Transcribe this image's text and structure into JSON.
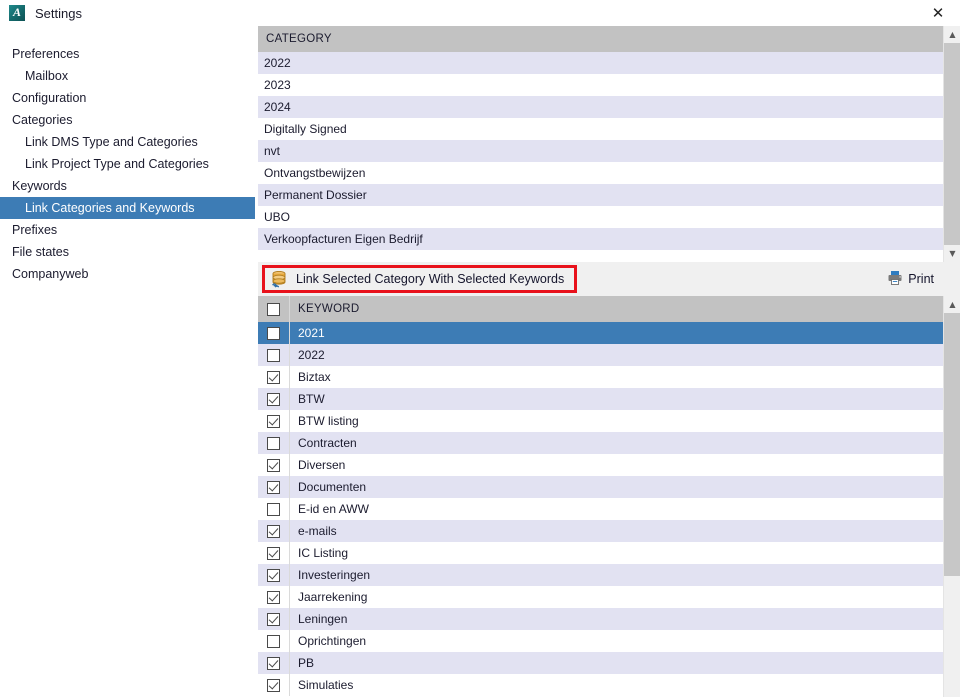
{
  "window": {
    "title": "Settings",
    "app_icon": "app-logo-icon",
    "close_label": "✕"
  },
  "sidebar": {
    "items": [
      {
        "label": "Preferences",
        "level": 0,
        "selected": false
      },
      {
        "label": "Mailbox",
        "level": 1,
        "selected": false
      },
      {
        "label": "Configuration",
        "level": 0,
        "selected": false
      },
      {
        "label": "Categories",
        "level": 0,
        "selected": false
      },
      {
        "label": "Link DMS Type and Categories",
        "level": 1,
        "selected": false
      },
      {
        "label": "Link Project Type and Categories",
        "level": 1,
        "selected": false
      },
      {
        "label": "Keywords",
        "level": 0,
        "selected": false
      },
      {
        "label": "Link Categories and Keywords",
        "level": 1,
        "selected": true
      },
      {
        "label": "Prefixes",
        "level": 0,
        "selected": false
      },
      {
        "label": "File states",
        "level": 0,
        "selected": false
      },
      {
        "label": "Companyweb",
        "level": 0,
        "selected": false
      }
    ]
  },
  "category_grid": {
    "header": "CATEGORY",
    "rows": [
      {
        "label": "2022",
        "selected": false
      },
      {
        "label": "2023",
        "selected": false
      },
      {
        "label": "2024",
        "selected": false
      },
      {
        "label": "Digitally Signed",
        "selected": false
      },
      {
        "label": "nvt",
        "selected": false
      },
      {
        "label": "Ontvangstbewijzen",
        "selected": false
      },
      {
        "label": "Permanent Dossier",
        "selected": false
      },
      {
        "label": "UBO",
        "selected": false
      },
      {
        "label": "Verkoopfacturen Eigen Bedrijf",
        "selected": false
      }
    ],
    "scrollbar": {
      "up_arrow": "▲",
      "down_arrow": "▼"
    }
  },
  "toolbar": {
    "link_button_label": "Link Selected Category With Selected Keywords",
    "link_button_icon": "database-link-icon",
    "print_button_label": "Print",
    "print_button_icon": "printer-icon",
    "highlight_color": "#e8111b"
  },
  "keyword_grid": {
    "header": "KEYWORD",
    "header_checkbox_checked": false,
    "rows": [
      {
        "label": "2021",
        "checked": false,
        "selected": true
      },
      {
        "label": "2022",
        "checked": false,
        "selected": false
      },
      {
        "label": "Biztax",
        "checked": true,
        "selected": false
      },
      {
        "label": "BTW",
        "checked": true,
        "selected": false
      },
      {
        "label": "BTW listing",
        "checked": true,
        "selected": false
      },
      {
        "label": "Contracten",
        "checked": false,
        "selected": false
      },
      {
        "label": "Diversen",
        "checked": true,
        "selected": false
      },
      {
        "label": "Documenten",
        "checked": true,
        "selected": false
      },
      {
        "label": "E-id en AWW",
        "checked": false,
        "selected": false
      },
      {
        "label": "e-mails",
        "checked": true,
        "selected": false
      },
      {
        "label": "IC Listing",
        "checked": true,
        "selected": false
      },
      {
        "label": "Investeringen",
        "checked": true,
        "selected": false
      },
      {
        "label": "Jaarrekening",
        "checked": true,
        "selected": false
      },
      {
        "label": "Leningen",
        "checked": true,
        "selected": false
      },
      {
        "label": "Oprichtingen",
        "checked": false,
        "selected": false
      },
      {
        "label": "PB",
        "checked": true,
        "selected": false
      },
      {
        "label": "Simulaties",
        "checked": true,
        "selected": false
      }
    ],
    "scrollbar": {
      "up_arrow": "▲"
    }
  },
  "colors": {
    "selection_blue": "#3d7cb5",
    "header_gray": "#c2c2c2",
    "alt_row": "#e2e2f2",
    "toolbar_gray": "#f0f0f0"
  }
}
